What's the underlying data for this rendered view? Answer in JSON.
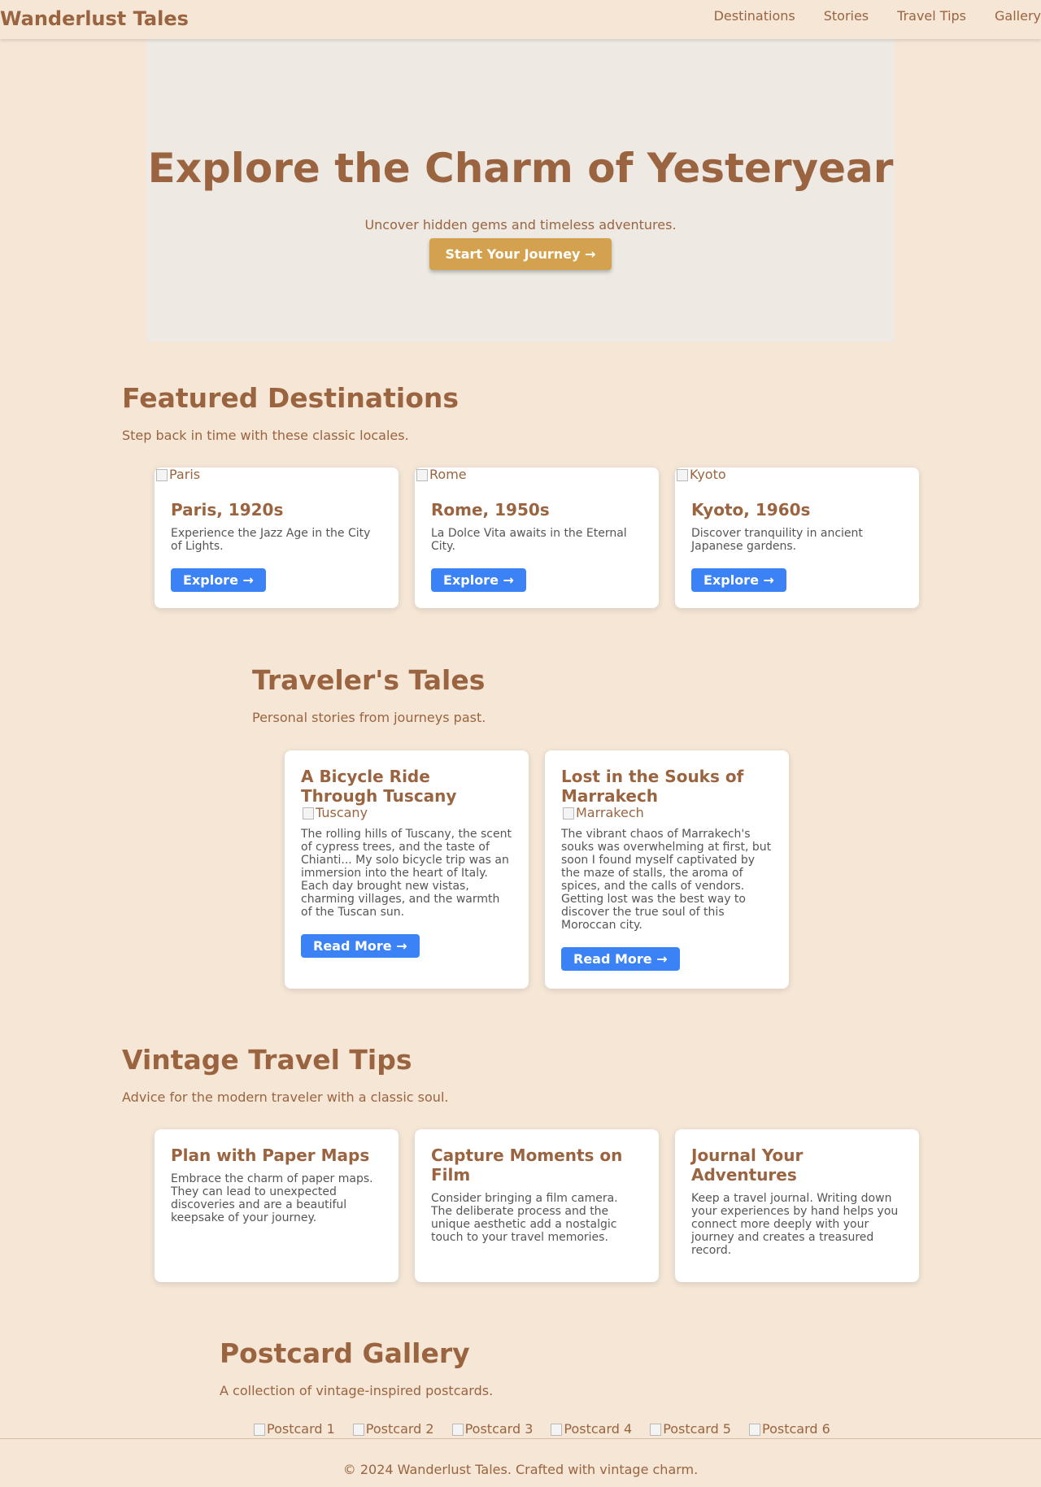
{
  "nav": {
    "brand": "Wanderlust Tales",
    "links": [
      "Destinations",
      "Stories",
      "Travel Tips",
      "Gallery"
    ]
  },
  "hero": {
    "title": "Explore the Charm of Yesteryear",
    "subtitle": "Uncover hidden gems and timeless adventures.",
    "cta": "Start Your Journey →"
  },
  "destinations": {
    "title": "Featured Destinations",
    "subtitle": "Step back in time with these classic locales.",
    "cards": [
      {
        "image_alt": "Paris",
        "title": "Paris, 1920s",
        "text": "Experience the Jazz Age in the City of Lights.",
        "button": "Explore →"
      },
      {
        "image_alt": "Rome",
        "title": "Rome, 1950s",
        "text": "La Dolce Vita awaits in the Eternal City.",
        "button": "Explore →"
      },
      {
        "image_alt": "Kyoto",
        "title": "Kyoto, 1960s",
        "text": "Discover tranquility in ancient Japanese gardens.",
        "button": "Explore →"
      }
    ]
  },
  "stories": {
    "title": "Traveler's Tales",
    "subtitle": "Personal stories from journeys past.",
    "cards": [
      {
        "title": "A Bicycle Ride Through Tuscany",
        "image_alt": "Tuscany",
        "text": "The rolling hills of Tuscany, the scent of cypress trees, and the taste of Chianti... My solo bicycle trip was an immersion into the heart of Italy. Each day brought new vistas, charming villages, and the warmth of the Tuscan sun.",
        "button": "Read More →"
      },
      {
        "title": "Lost in the Souks of Marrakech",
        "image_alt": "Marrakech",
        "text": "The vibrant chaos of Marrakech's souks was overwhelming at first, but soon I found myself captivated by the maze of stalls, the aroma of spices, and the calls of vendors. Getting lost was the best way to discover the true soul of this Moroccan city.",
        "button": "Read More →"
      }
    ]
  },
  "tips": {
    "title": "Vintage Travel Tips",
    "subtitle": "Advice for the modern traveler with a classic soul.",
    "cards": [
      {
        "title": "Plan with Paper Maps",
        "text": "Embrace the charm of paper maps. They can lead to unexpected discoveries and are a beautiful keepsake of your journey."
      },
      {
        "title": "Capture Moments on Film",
        "text": "Consider bringing a film camera. The deliberate process and the unique aesthetic add a nostalgic touch to your travel memories."
      },
      {
        "title": "Journal Your Adventures",
        "text": "Keep a travel journal. Writing down your experiences by hand helps you connect more deeply with your journey and creates a treasured record."
      }
    ]
  },
  "gallery": {
    "title": "Postcard Gallery",
    "subtitle": "A collection of vintage-inspired postcards.",
    "images": [
      "Postcard 1",
      "Postcard 2",
      "Postcard 3",
      "Postcard 4",
      "Postcard 5",
      "Postcard 6"
    ]
  },
  "footer": {
    "text": "© 2024 Wanderlust Tales. Crafted with vintage charm."
  }
}
